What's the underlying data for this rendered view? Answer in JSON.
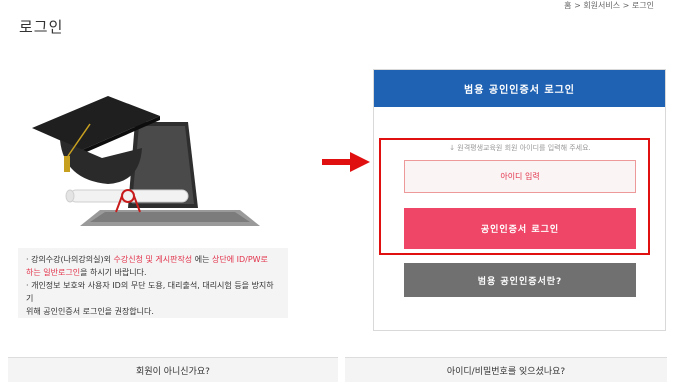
{
  "breadcrumb": {
    "text": "홈 > 회원서비스 > 로그인"
  },
  "page": {
    "title": "로그인"
  },
  "notice": {
    "line1_a": "· 강의수강(나의강의실)외 ",
    "line1_b": "수강신청 및 게시판작성",
    "line1_c": " 에는 ",
    "line1_d": "상단에 ID/PW로",
    "line2_a": "하는 일반로그인",
    "line2_b": "을 하시기 바랍니다.",
    "line3": "· 개인정보 보호와 사용자 ID의 무단 도용, 대리출석, 대리시험 등을 방지하기",
    "line4": "위해 공인인증서 로그인을 권장합니다."
  },
  "login_panel": {
    "header": "범용 공인인증서 로그인",
    "hint": "↓ 원격평생교육원 회원 아이디를 입력해 주세요.",
    "id_placeholder": "아이디 입력",
    "cert_login_label": "공인인증서 로그인",
    "cert_info_label": "범용 공인인증서란?"
  },
  "footer": {
    "non_member": "회원이 아니신가요?",
    "forgot": "아이디/비밀번호를 잊으셨나요?"
  },
  "colors": {
    "header_blue": "#1f62b3",
    "accent_pink": "#ef4566",
    "gray_button": "#707070",
    "annotation_red": "#e01010"
  }
}
